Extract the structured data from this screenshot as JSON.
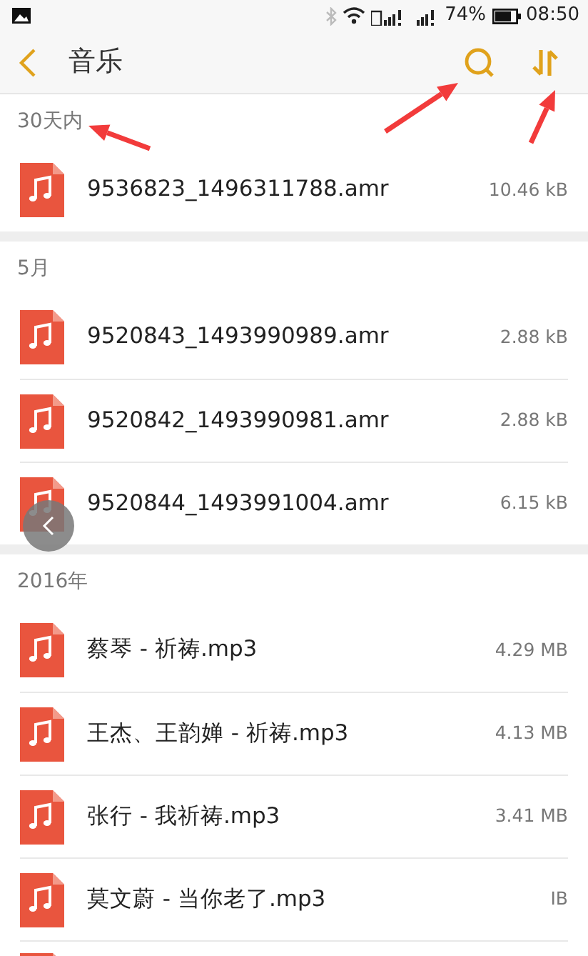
{
  "status_bar": {
    "battery": "74%",
    "time": "08:50"
  },
  "toolbar": {
    "title": "音乐"
  },
  "sections": [
    {
      "header": "30天内",
      "files": [
        {
          "name": "9536823_1496311788.amr",
          "size": "10.46 kB"
        }
      ]
    },
    {
      "header": "5月",
      "files": [
        {
          "name": "9520843_1493990989.amr",
          "size": "2.88 kB"
        },
        {
          "name": "9520842_1493990981.amr",
          "size": "2.88 kB"
        },
        {
          "name": "9520844_1493991004.amr",
          "size": "6.15 kB"
        }
      ]
    },
    {
      "header": "2016年",
      "files": [
        {
          "name": "蔡琴 - 祈祷.mp3",
          "size": "4.29 MB"
        },
        {
          "name": "王杰、王韵婵 - 祈祷.mp3",
          "size": "4.13 MB"
        },
        {
          "name": "张行 - 我祈祷.mp3",
          "size": "3.41 MB"
        },
        {
          "name": "莫文蔚 - 当你老了.mp3",
          "size": "IB"
        },
        {
          "kind": "partial"
        }
      ]
    }
  ]
}
